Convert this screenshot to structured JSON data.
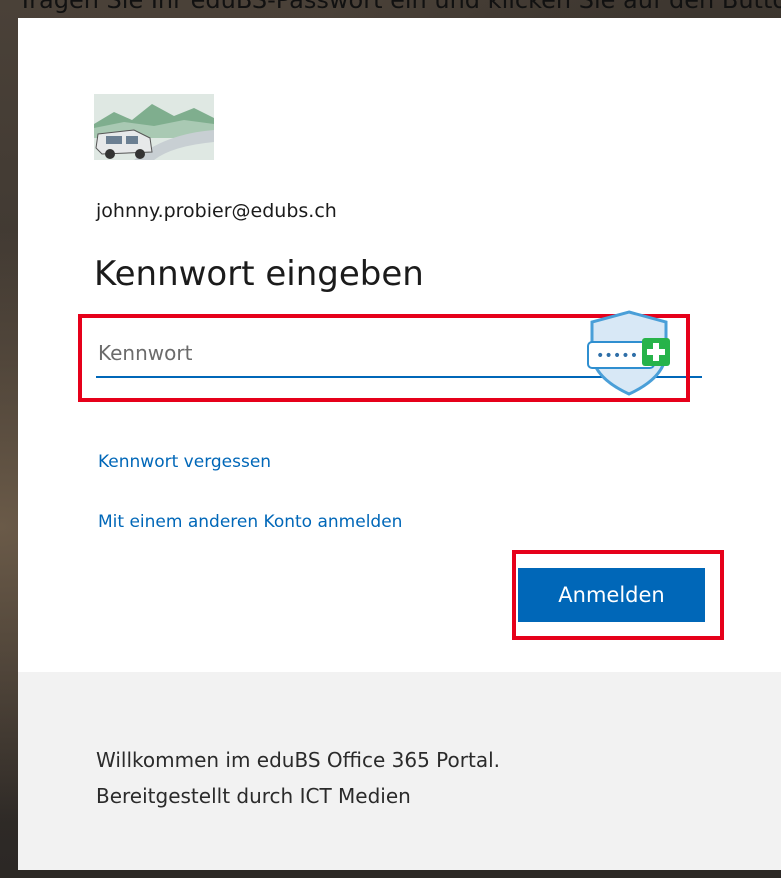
{
  "caption": "Tragen Sie Ihr eduBS-Passwort ein und klicken Sie auf den Button",
  "account": {
    "email": "johnny.probier@edubs.ch"
  },
  "form": {
    "title": "Kennwort eingeben",
    "password_placeholder": "Kennwort",
    "password_value": ""
  },
  "links": {
    "forgot": "Kennwort vergessen",
    "other_account": "Mit einem anderen Konto anmelden"
  },
  "buttons": {
    "signin": "Anmelden"
  },
  "footer": {
    "line1": "Willkommen im eduBS Office 365 Portal.",
    "line2": "Bereitgestellt durch ICT Medien"
  },
  "colors": {
    "accent": "#0067b8",
    "highlight": "#e6001a",
    "footer_bg": "#f2f2f2"
  },
  "icons": {
    "logo": "car-landscape-logo",
    "password_manager": "password-manager-shield-icon"
  }
}
